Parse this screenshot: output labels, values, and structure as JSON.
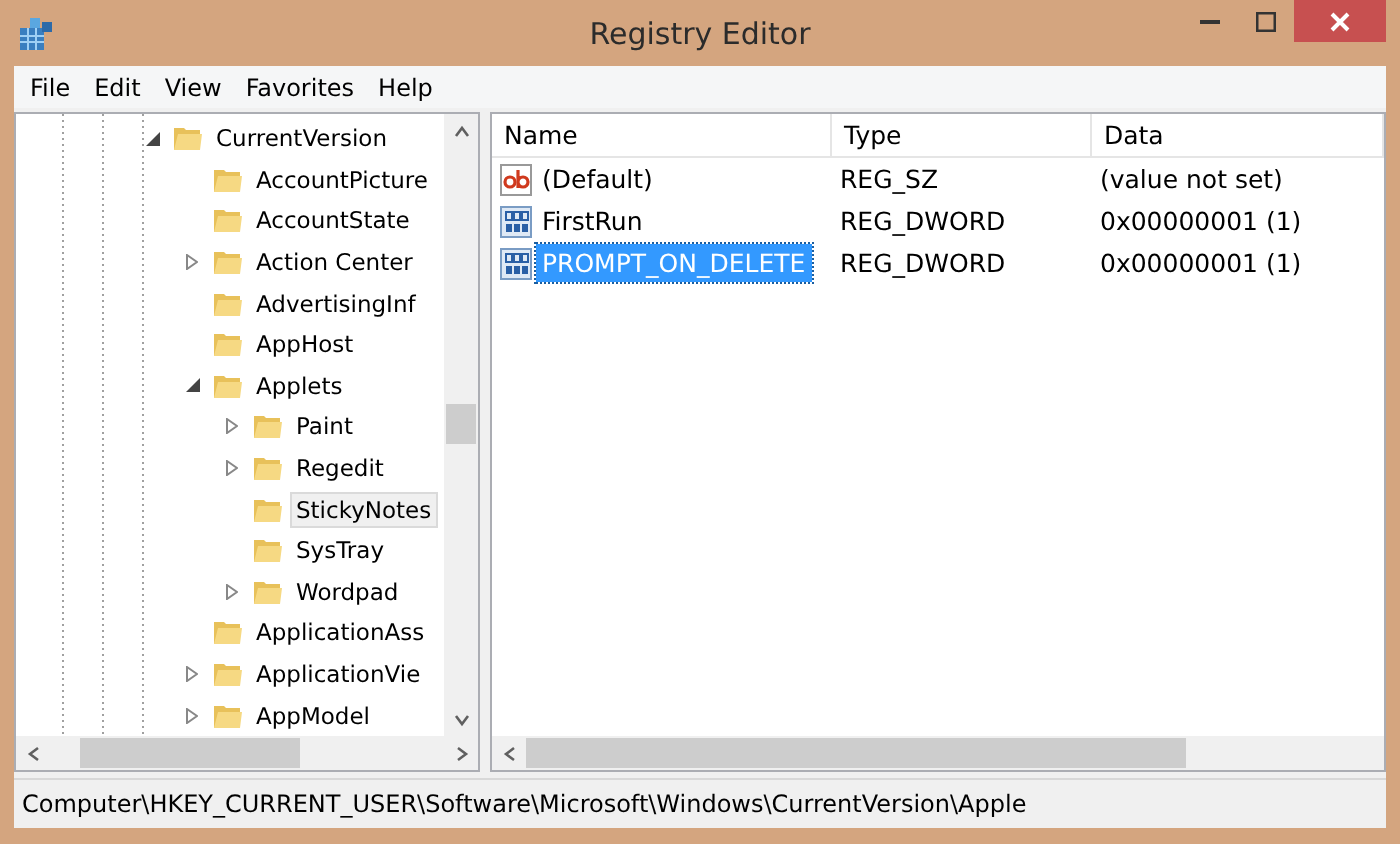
{
  "window": {
    "title": "Registry Editor"
  },
  "menu": [
    "File",
    "Edit",
    "View",
    "Favorites",
    "Help"
  ],
  "tree": [
    {
      "label": "CurrentVersion",
      "expanded": true,
      "selected": false,
      "children": [
        {
          "label": "AccountPicture",
          "selected": false
        },
        {
          "label": "AccountState",
          "selected": false
        },
        {
          "label": "Action Center",
          "expanded": false,
          "selected": false
        },
        {
          "label": "AdvertisingInf",
          "selected": false
        },
        {
          "label": "AppHost",
          "selected": false
        },
        {
          "label": "Applets",
          "expanded": true,
          "selected": false,
          "children": [
            {
              "label": "Paint",
              "expanded": false,
              "selected": false
            },
            {
              "label": "Regedit",
              "expanded": false,
              "selected": false
            },
            {
              "label": "StickyNotes",
              "selected": true
            },
            {
              "label": "SysTray",
              "selected": false
            },
            {
              "label": "Wordpad",
              "expanded": false,
              "selected": false
            }
          ]
        },
        {
          "label": "ApplicationAss",
          "selected": false
        },
        {
          "label": "ApplicationVie",
          "expanded": false,
          "selected": false
        },
        {
          "label": "AppModel",
          "expanded": false,
          "selected": false
        }
      ]
    }
  ],
  "values": {
    "columns": [
      "Name",
      "Type",
      "Data"
    ],
    "rows": [
      {
        "kind": "string",
        "name": "(Default)",
        "type": "REG_SZ",
        "data": "(value not set)",
        "selected": false
      },
      {
        "kind": "binary",
        "name": "FirstRun",
        "type": "REG_DWORD",
        "data": "0x00000001 (1)",
        "selected": false
      },
      {
        "kind": "binary",
        "name": "PROMPT_ON_DELETE",
        "type": "REG_DWORD",
        "data": "0x00000001 (1)",
        "selected": true
      }
    ]
  },
  "status_bar": "Computer\\HKEY_CURRENT_USER\\Software\\Microsoft\\Windows\\CurrentVersion\\Apple"
}
